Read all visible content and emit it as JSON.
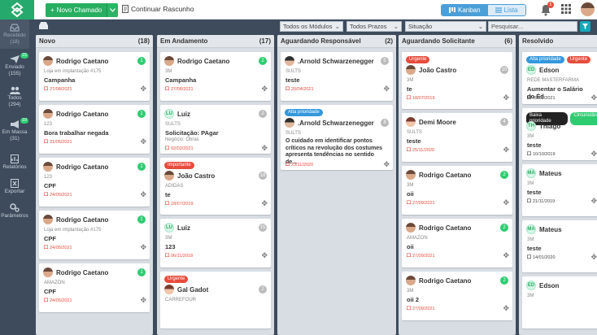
{
  "topbar": {
    "new_button": "Novo Chamado",
    "draft": "Continuar Rascunho",
    "kanban": "Kanban",
    "lista": "Lista",
    "notif_count": "5"
  },
  "sidebar": [
    {
      "label": "Recebido",
      "count": "(18)",
      "icon": "inbox-icon"
    },
    {
      "label": "Enviado",
      "count": "(155)",
      "badge": "15",
      "icon": "send-icon"
    },
    {
      "label": "Todos",
      "count": "(294)",
      "icon": "users-icon"
    },
    {
      "label": "Em Massa",
      "count": "(31)",
      "badge": "10",
      "icon": "megaphone-icon"
    },
    {
      "label": "Relatórios",
      "icon": "report-icon"
    },
    {
      "label": "Exportar",
      "icon": "export-icon"
    },
    {
      "label": "Parâmetros",
      "icon": "gear-icon"
    }
  ],
  "filters": {
    "modules": "Todos os Módulos",
    "deadlines": "Todos Prazos",
    "situation": "Situação",
    "search_placeholder": "Pesquisar..."
  },
  "columns": [
    {
      "title": "Novo",
      "count": "(18)"
    },
    {
      "title": "Em Andamento",
      "count": "(17)"
    },
    {
      "title": "Aguardando Responsável",
      "count": "(2)"
    },
    {
      "title": "Aguardando Solicitante",
      "count": "(6)"
    },
    {
      "title": "Resolvido",
      "count": ""
    }
  ],
  "col0": [
    {
      "name": "Rodrigo Caetano",
      "count": "1",
      "sub": "Loja em implantação #175",
      "title": "Campanha",
      "date": "27/08/2021"
    },
    {
      "name": "Rodrigo Caetano",
      "count": "1",
      "sub": "123",
      "title": "Bora trabalhar negada",
      "date": "31/05/2021"
    },
    {
      "name": "Rodrigo Caetano",
      "count": "1",
      "sub": "123",
      "title": "CPF",
      "date": "24/05/2021"
    },
    {
      "name": "Rodrigo Caetano",
      "count": "1",
      "sub": "Loja em implantação #175",
      "title": "CPF",
      "date": "24/05/2021"
    },
    {
      "name": "Rodrigo Caetano",
      "count": "1",
      "sub": "AMAZON",
      "title": "CPF",
      "date": "24/05/2021"
    }
  ],
  "col1": [
    {
      "name": "Rodrigo Caetano",
      "count": "2",
      "sub": "3M",
      "title": "Campanha",
      "date": "27/08/2021"
    },
    {
      "name": "Luiz",
      "initials": "LU",
      "count": "2",
      "sub": "SULTS",
      "title": "Solicitação: PAgar",
      "sub2": "Negócio: Obras",
      "date": "02/02/2021"
    },
    {
      "tag": "Importante",
      "name": "João Castro",
      "count": "18",
      "sub": "ADIDAS",
      "title": "te",
      "date": "18/07/2019"
    },
    {
      "name": "Luiz",
      "initials": "LU",
      "count": "15",
      "sub": "3M",
      "title": "123",
      "date": "06/11/2018"
    },
    {
      "tag": "Urgente",
      "name": "Gal Gadot",
      "count": "2",
      "sub": "CARREFOUR"
    }
  ],
  "col2": [
    {
      "name": ".Arnold Schwarzenegger",
      "count": "5",
      "sub": "SULTS",
      "title": "teste",
      "date": "20/04/2021"
    },
    {
      "tag": "Alta prioridade",
      "name": ".Arnold Schwarzenegger",
      "count": "8",
      "sub": "SULTS",
      "title": "O cuidado em identificar pontos críticos na revolução dos costumes apresenta tendências no sentido de...",
      "date": "23/11/2020"
    }
  ],
  "col3": [
    {
      "tag": "Urgente",
      "name": "João Castro",
      "count": "10",
      "sub": "3M",
      "title": "te",
      "date": "18/07/2019"
    },
    {
      "name": "Demi Moore",
      "count": "4",
      "sub": "SULTS",
      "title": "teste",
      "date": "25/11/2020"
    },
    {
      "name": "Rodrigo Caetano",
      "count": "2",
      "sub": "3M",
      "title": "oii",
      "date": "27/09/2021"
    },
    {
      "name": "Rodrigo Caetano",
      "count": "2",
      "sub": "AMAZON",
      "title": "oii",
      "date": "27/09/2021"
    },
    {
      "name": "Rodrigo Caetano",
      "count": "2",
      "sub": "3M",
      "title": "oii 2",
      "date": "27/09/2021"
    }
  ],
  "col4": [
    {
      "tags": [
        "Alta prioridade",
        "Urgente"
      ],
      "name": "Edson",
      "initials": "ED",
      "sub": "REDE MASTERFARMA",
      "title": "Aumentar o Salário do Éd",
      "date": "09/02/2021"
    },
    {
      "tags": [
        "Baixa prioridade",
        "Circunstân"
      ],
      "name": "Thiago",
      "initials": "TH",
      "sub": "3M",
      "title": "teste",
      "date": "10/10/2019"
    },
    {
      "name": "Mateus",
      "initials": "MA",
      "sub": "3M",
      "title": "teste",
      "date": "21/11/2019"
    },
    {
      "name": "Mateus",
      "initials": "MA",
      "sub": "3M",
      "title": "teste",
      "date": "14/01/2020"
    },
    {
      "name": "Edson",
      "initials": "ED",
      "sub": "3M"
    }
  ]
}
